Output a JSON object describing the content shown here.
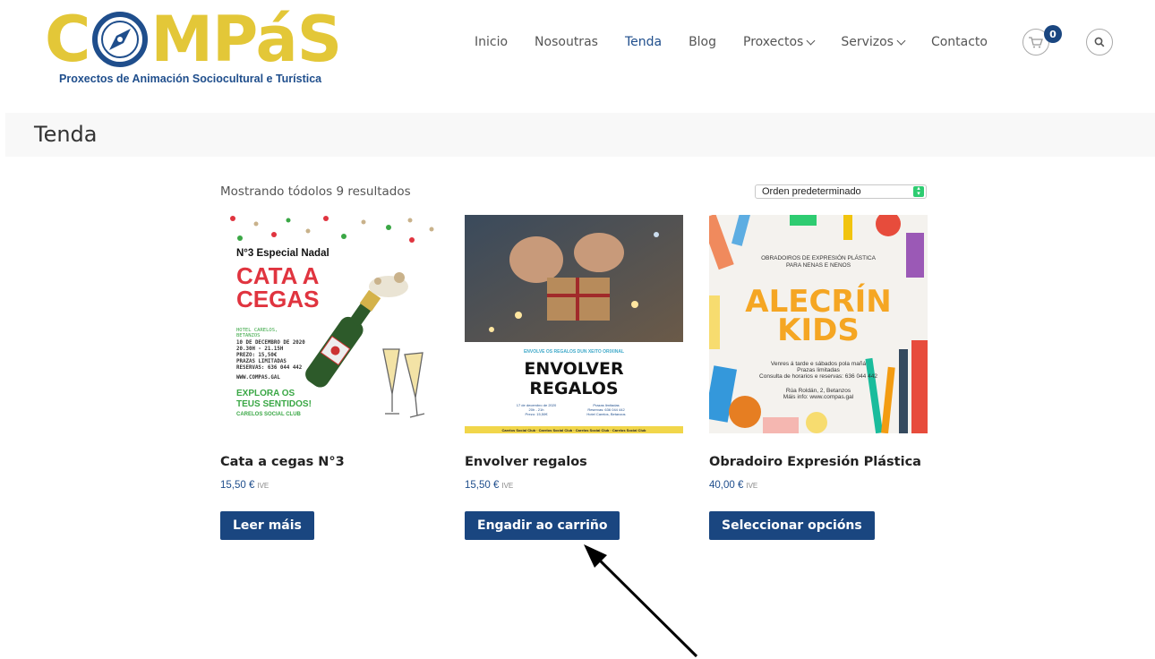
{
  "logo": {
    "wordmark_left": "C",
    "wordmark_right": "MPáS",
    "tagline": "Proxectos de Animación Sociocultural e Turística"
  },
  "nav": {
    "items": [
      {
        "label": "Inicio"
      },
      {
        "label": "Nosoutras"
      },
      {
        "label": "Tenda"
      },
      {
        "label": "Blog"
      },
      {
        "label": "Proxectos"
      },
      {
        "label": "Servizos"
      },
      {
        "label": "Contacto"
      }
    ],
    "cart_count": "0"
  },
  "page": {
    "title": "Tenda"
  },
  "shop": {
    "results_text": "Mostrando tódolos 9 resultados",
    "sort_selected": "Orden predeterminado"
  },
  "products": [
    {
      "name": "Cata a cegas N°3",
      "price": "15,50 €",
      "tax": "IVE",
      "button": "Leer máis",
      "img": {
        "subtitle": "N°3 Especial Nadal",
        "title1": "CATA A",
        "title2": "CEGAS",
        "d1": "HOTEL CARELOS,",
        "d2": "BETANZOS",
        "d3": "10 DE DECEMBRO DE 2020",
        "d4": "20.30H - 21.15H",
        "d5": "PREZO: 15,50€",
        "d6": "PRAZAS LIMITADAS",
        "d7": "RESERVAS: 636 044 442",
        "web": "WWW.COMPAS.GAL",
        "slogan1": "EXPLORA OS",
        "slogan2": "TEUS SENTIDOS!",
        "club": "CARELOS SOCIAL CLUB"
      }
    },
    {
      "name": "Envolver regalos",
      "price": "15,50 €",
      "tax": "IVE",
      "button": "Engadir ao carriño",
      "img": {
        "tagline": "ENVOLVE OS REGALOS DUN XEITO ORIXINAL",
        "title1": "ENVOLVER",
        "title2": "REGALOS",
        "l1": "17 de decembro de 2020",
        "l2": "20h - 21h",
        "l3": "Prezo: 15,50€",
        "r1": "Prazas limitadas",
        "r2": "Reservas: 636 044 442",
        "r3": "Hotel Carelos, Betanzos",
        "footer": "Carelos Social Club · Carelos Social Club · Carelos Social Club · Carelos Social Club"
      }
    },
    {
      "name": "Obradoiro Expresión Plástica",
      "price": "40,00 €",
      "tax": "IVE",
      "button": "Seleccionar opcións",
      "img": {
        "h1": "OBRADOIROS DE EXPRESIÓN PLÁSTICA",
        "h2": "PARA NENAS E NENOS",
        "title1": "ALECRÍN",
        "title2": "KIDS",
        "p1": "Venres á tarde e sábados pola mañá",
        "p2": "Prazas limitadas",
        "p3": "Consulta de horarios e reservas: 636 044 442",
        "p4": "Rúa Roldán, 2, Betanzos",
        "p5": "Máis info: www.compas.gal"
      }
    }
  ],
  "colors": {
    "brand_blue": "#1a4680",
    "logo_gold": "#e3c738",
    "cata_red": "#e0343f",
    "cata_green": "#3aa745",
    "alecrin_orange": "#f5a623"
  }
}
